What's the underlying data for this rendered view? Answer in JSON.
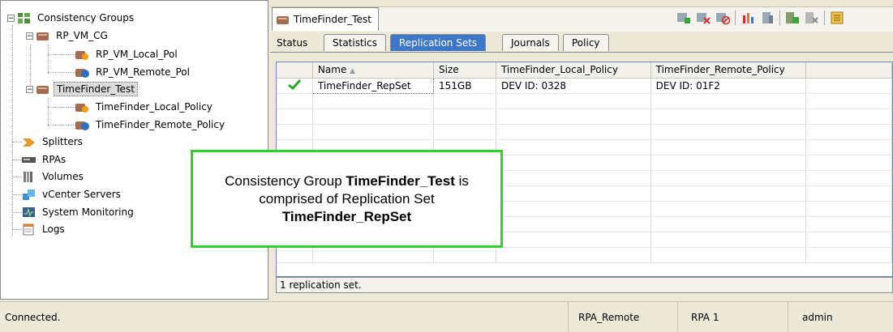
{
  "tree": {
    "root_label": "Consistency Groups",
    "groups": [
      {
        "label": "RP_VM_CG",
        "children": [
          "RP_VM_Local_Pol",
          "RP_VM_Remote_Pol"
        ]
      },
      {
        "label": "TimeFinder_Test",
        "children": [
          "TimeFinder_Local_Policy",
          "TimeFinder_Remote_Policy"
        ]
      }
    ],
    "items": [
      "Splitters",
      "RPAs",
      "Volumes",
      "vCenter Servers",
      "System Monitoring",
      "Logs"
    ]
  },
  "panel": {
    "title": "TimeFinder_Test",
    "tabs": [
      "Status",
      "Statistics",
      "Replication Sets",
      "Journals",
      "Policy"
    ],
    "active_tab": "Replication Sets"
  },
  "grid": {
    "columns": [
      "Name",
      "Size",
      "TimeFinder_Local_Policy",
      "TimeFinder_Remote_Policy"
    ],
    "sort_indicator": "▲",
    "rows": [
      {
        "status": "ok",
        "name": "TimeFinder_RepSet",
        "size": "151GB",
        "local": "DEV ID: 0328",
        "remote": "DEV ID: 01F2"
      }
    ],
    "footer": "1 replication set."
  },
  "callout": {
    "line1_prefix": "Consistency Group ",
    "line1_bold": "TimeFinder_Test",
    "line1_suffix": " is",
    "line2": "comprised of Replication Set",
    "line3_bold": "TimeFinder_RepSet"
  },
  "statusbar": {
    "status": "Connected.",
    "cluster": "RPA_Remote",
    "rpa": "RPA 1",
    "user": "admin"
  },
  "colors": {
    "active_tab": "#3c77c9",
    "callout_border": "#2ed12e",
    "check": "#2aa52a"
  }
}
